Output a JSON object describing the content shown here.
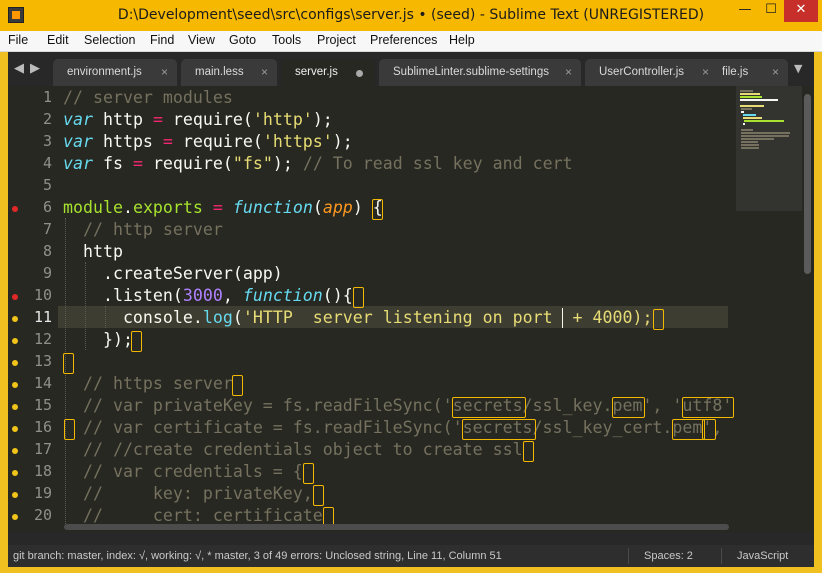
{
  "window": {
    "title": "D:\\Development\\seed\\src\\configs\\server.js • (seed) - Sublime Text (UNREGISTERED)",
    "minimize": "—",
    "maximize": "☐",
    "close": "✕"
  },
  "menu": [
    "File",
    "Edit",
    "Selection",
    "Find",
    "View",
    "Goto",
    "Tools",
    "Project",
    "Preferences",
    "Help"
  ],
  "tabs": [
    {
      "label": "environment.js",
      "active": false,
      "dirty": false
    },
    {
      "label": "main.less",
      "active": false,
      "dirty": false
    },
    {
      "label": "server.js",
      "active": true,
      "dirty": true
    },
    {
      "label": "SublimeLinter.sublime-settings",
      "active": false,
      "dirty": false
    },
    {
      "label": "UserController.js",
      "active": false,
      "dirty": false
    },
    {
      "label": "file.js",
      "active": false,
      "dirty": false
    }
  ],
  "tab_nav": {
    "prev": "◀",
    "next": "▶",
    "overflow": "▼",
    "close_glyph": "×"
  },
  "editor": {
    "current_line": 11,
    "line_numbers": [
      1,
      2,
      3,
      4,
      5,
      6,
      7,
      8,
      9,
      10,
      11,
      12,
      13,
      14,
      15,
      16,
      17,
      18,
      19,
      20
    ],
    "gutter_marks": {
      "6": "error",
      "10": "error",
      "11": "warning",
      "12": "warning",
      "13": "warning",
      "14": "warning",
      "15": "warning",
      "16": "warning",
      "17": "warning",
      "18": "warning",
      "19": "warning",
      "20": "warning"
    },
    "lines": [
      "// server modules",
      "var http = require('http');",
      "var https = require('https');",
      "var fs = require(\"fs\"); // To read ssl key and cert",
      "",
      "module.exports = function(app) {",
      "  // http server",
      "  http",
      "    .createServer(app)",
      "    .listen(3000, function(){",
      "      console.log('HTTP  server listening on port  + 4000);",
      "    });",
      "",
      "  // https server",
      "  // var privateKey = fs.readFileSync('secrets/ssl_key.pem', 'utf8'",
      "  // var certificate = fs.readFileSync('secrets/ssl_key_cert.pem',",
      "  // //create credentials object to create ssl",
      "  // var credentials = {",
      "  //     key: privateKey,",
      "  //     cert: certificate"
    ]
  },
  "status": {
    "left": "git branch: master, index: √, working: √, * master, 3 of 49 errors: Unclosed string, Line 11, Column 51",
    "spaces": "Spaces: 2",
    "syntax": "JavaScript"
  },
  "colors": {
    "editor_bg": "#272822",
    "comment": "#75715e",
    "keyword": "#66d9ef",
    "operator": "#f92672",
    "string": "#e6db74",
    "number": "#ae81ff",
    "parameter": "#fd971f",
    "lint_box": "#f5b800",
    "error_dot": "#e02828",
    "title_bar": "#f6b800"
  }
}
